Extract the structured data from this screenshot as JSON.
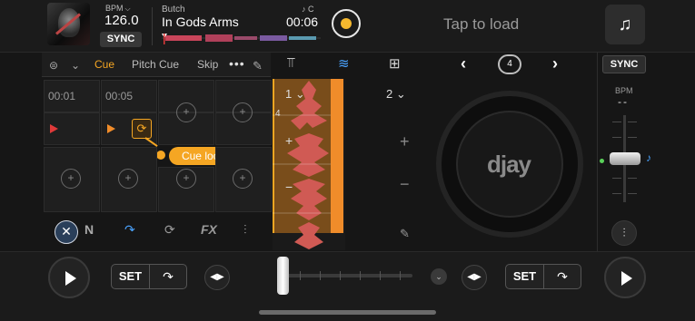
{
  "top": {
    "bpm_label": "BPM",
    "bpm_value": "126.0",
    "sync": "SYNC",
    "artist": "Butch",
    "title": "In Gods Arms",
    "time": "00:06",
    "tap_to_load": "Tap to load"
  },
  "tabs": {
    "items": [
      "Cue",
      "Pitch Cue",
      "Skip"
    ],
    "active": "Cue"
  },
  "pads": {
    "cue1_time": "00:01",
    "cue2_time": "00:05",
    "tooltip": "Cue loop"
  },
  "tools": {
    "fx": "FX"
  },
  "strip": {
    "beat_left": "1",
    "beat_right": "2",
    "marker": "4"
  },
  "deck_right": {
    "loop_beats": "4",
    "logo": "djay",
    "sync": "SYNC",
    "bpm_label": "BPM",
    "bpm_value": "--"
  },
  "transport": {
    "set_left": "SET",
    "set_right": "SET"
  },
  "colors": {
    "accent": "#f5a623",
    "cue_red": "#e03a3a",
    "cue_orange": "#f08c2a",
    "blue": "#4aa3ff"
  }
}
